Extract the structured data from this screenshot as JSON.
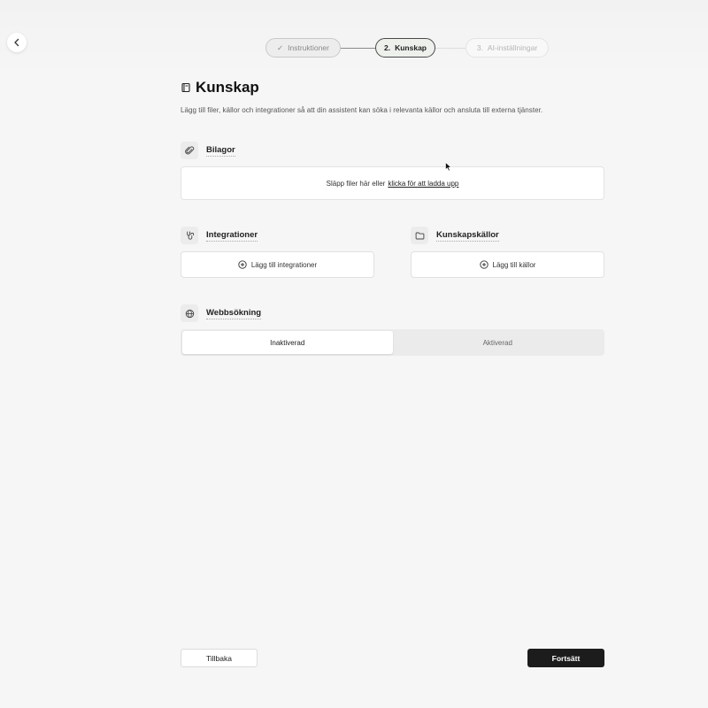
{
  "stepper": {
    "steps": [
      {
        "label": "Instruktioner",
        "prefix": "✓",
        "state": "done"
      },
      {
        "label": "Kunskap",
        "prefix": "2.",
        "state": "active"
      },
      {
        "label": "AI-inställningar",
        "prefix": "3.",
        "state": "upcoming"
      }
    ]
  },
  "page": {
    "title": "Kunskap",
    "subtitle": "Lägg till filer, källor och integrationer så att din assistent kan söka i relevanta källor och ansluta till externa tjänster."
  },
  "attachments": {
    "label": "Bilagor",
    "drop_text": "Släpp filer här eller",
    "upload_link": "klicka för att ladda upp"
  },
  "integrations": {
    "label": "Integrationer",
    "add_label": "Lägg till integrationer"
  },
  "knowledge_sources": {
    "label": "Kunskapskällor",
    "add_label": "Lägg till källor"
  },
  "web_search": {
    "label": "Webbsökning",
    "options": [
      "Inaktiverad",
      "Aktiverad"
    ],
    "selected": "Inaktiverad"
  },
  "footer": {
    "back_label": "Tillbaka",
    "continue_label": "Fortsätt"
  },
  "icons": {
    "back": "chevron-left-icon",
    "title": "book-icon",
    "attachments": "paperclip-icon",
    "integrations": "plug-icon",
    "sources": "folder-icon",
    "web": "globe-icon",
    "add": "plus-circle-icon"
  }
}
